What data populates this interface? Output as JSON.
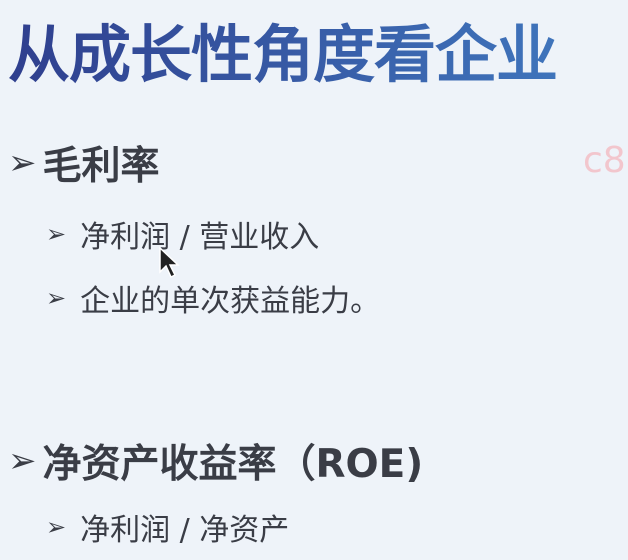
{
  "slide": {
    "title": "从成长性角度看企业",
    "watermark": "c8",
    "bullet_icon": "arrow-bullet-icon",
    "sections": [
      {
        "heading": "毛利率",
        "items": [
          "净利润 / 营业收入",
          "企业的单次获益能力。"
        ]
      },
      {
        "heading": "净资产收益率（ROE)",
        "items": [
          "净利润 / 净资产"
        ]
      }
    ]
  },
  "colors": {
    "title_start": "#2f3f8e",
    "title_end": "#3f74bb",
    "text": "#3a3d46",
    "background": "#eef3f9",
    "watermark": "#f2c6cd"
  }
}
